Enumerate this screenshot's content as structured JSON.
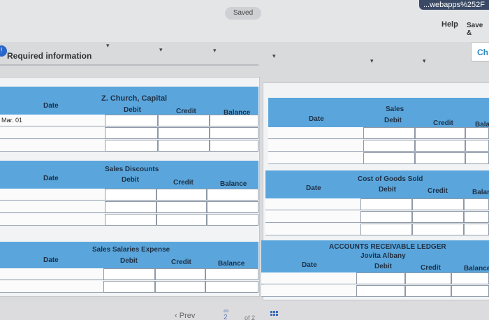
{
  "topbar": {
    "url_fragment": "...webapps%252F",
    "saved_label": "Saved",
    "help_label": "Help",
    "save_exit_label": "Save &",
    "check_label": "Ch"
  },
  "required_info": {
    "badge": "!",
    "label": "Required information"
  },
  "ledgers": {
    "church": {
      "title": "Z. Church, Capital",
      "date": "Date",
      "debit": "Debit",
      "credit": "Credit",
      "balance": "Balance",
      "first_row_date": "Mar. 01"
    },
    "sales": {
      "title": "Sales",
      "date": "Date",
      "debit": "Debit",
      "credit": "Credit",
      "balance": "Bala"
    },
    "sales_discounts": {
      "title": "Sales Discounts",
      "date": "Date",
      "debit": "Debit",
      "credit": "Credit",
      "balance": "Balance"
    },
    "cogs": {
      "title": "Cost of Goods Sold",
      "date": "Date",
      "debit": "Debit",
      "credit": "Credit",
      "balance": "Balan"
    },
    "salaries": {
      "title": "Sales Salaries Expense",
      "date": "Date",
      "debit": "Debit",
      "credit": "Credit",
      "balance": "Balance"
    },
    "ar": {
      "title": "ACCOUNTS RECEIVABLE LEDGER",
      "subtitle": "Jovita Albany",
      "date": "Date",
      "debit": "Debit",
      "credit": "Credit",
      "balance": "Balance"
    }
  },
  "footer": {
    "prev_label": "Prev",
    "page_current": "2",
    "page_of": "of 2"
  },
  "colors": {
    "header_blue": "#5aa6dc",
    "accent": "#2a66c8"
  }
}
